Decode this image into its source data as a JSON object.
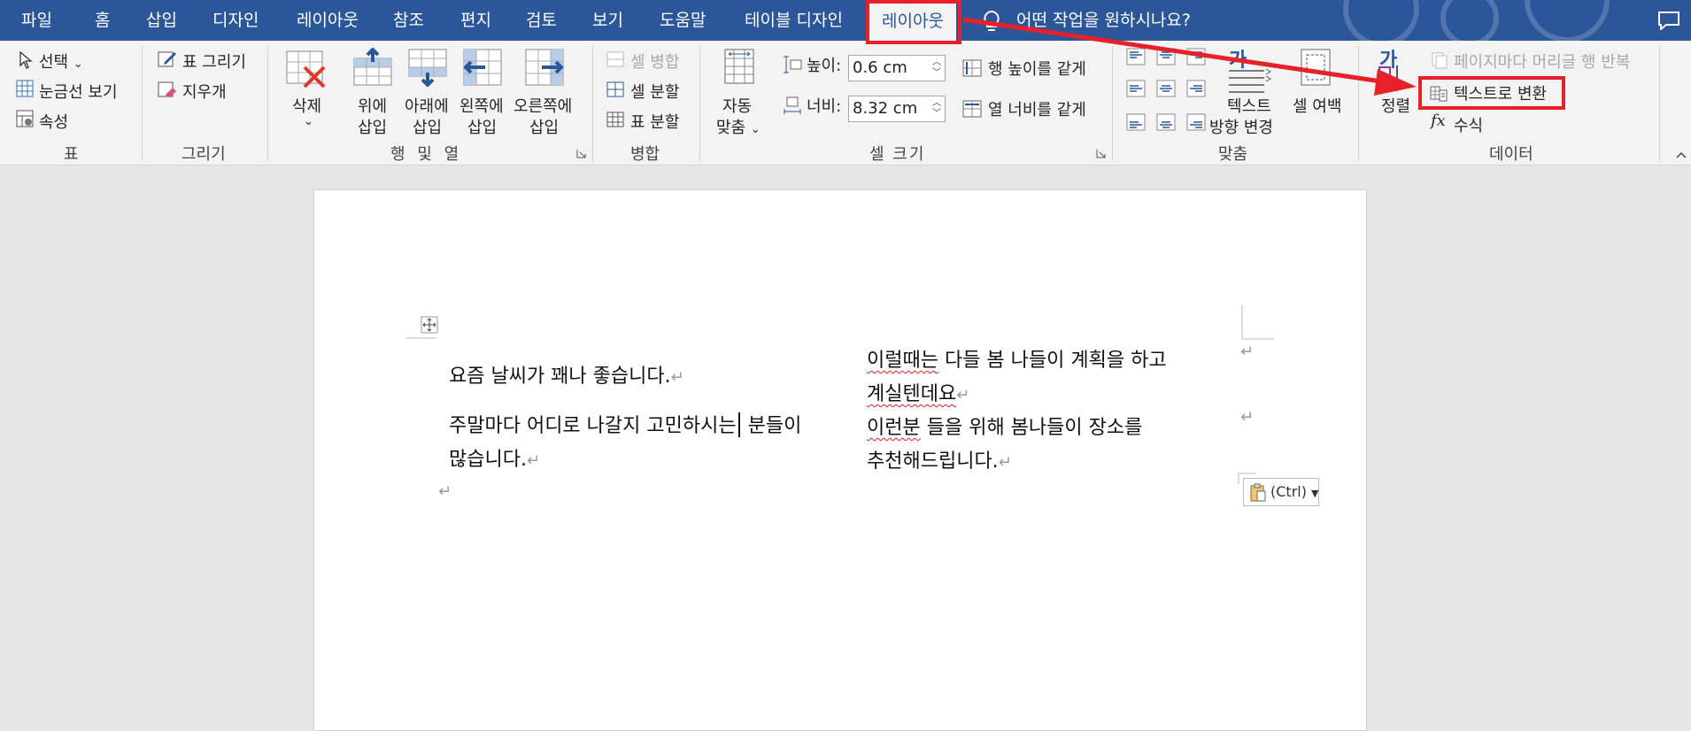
{
  "tabs": [
    {
      "id": "file",
      "label": "파일"
    },
    {
      "id": "home",
      "label": "홈"
    },
    {
      "id": "insert",
      "label": "삽입"
    },
    {
      "id": "design",
      "label": "디자인"
    },
    {
      "id": "layout1",
      "label": "레이아웃"
    },
    {
      "id": "references",
      "label": "참조"
    },
    {
      "id": "mailings",
      "label": "편지"
    },
    {
      "id": "review",
      "label": "검토"
    },
    {
      "id": "view",
      "label": "보기"
    },
    {
      "id": "help",
      "label": "도움말"
    },
    {
      "id": "table-design",
      "label": "테이블 디자인"
    },
    {
      "id": "table-layout",
      "label": "레이아웃"
    }
  ],
  "search": {
    "placeholder": "어떤 작업을 원하시나요?"
  },
  "ribbon": {
    "table": {
      "select": "선택",
      "gridlines": "눈금선 보기",
      "properties": "속성",
      "label": "표"
    },
    "draw": {
      "draw_table": "표 그리기",
      "eraser": "지우개",
      "label": "그리기"
    },
    "rows_cols": {
      "delete": "삭제",
      "insert_above_1": "위에",
      "insert_above_2": "삽입",
      "insert_below_1": "아래에",
      "insert_below_2": "삽입",
      "insert_left_1": "왼쪽에",
      "insert_left_2": "삽입",
      "insert_right_1": "오른쪽에",
      "insert_right_2": "삽입",
      "label": "행 및 열"
    },
    "merge": {
      "merge_cells": "셀 병합",
      "split_cells": "셀 분할",
      "split_table": "표 분할",
      "label": "병합"
    },
    "cell_size": {
      "autofit_1": "자동",
      "autofit_2": "맞춤",
      "height_label": "높이:",
      "height_value": "0.6 cm",
      "width_label": "너비:",
      "width_value": "8.32 cm",
      "distribute_rows": "행 높이를 같게",
      "distribute_cols": "열 너비를 같게",
      "label": "셀 크기"
    },
    "alignment": {
      "text_dir_glyph": "가",
      "text_dir_1": "텍스트",
      "text_dir_2": "방향 변경",
      "margins": "셀 여백",
      "label": "맞춤"
    },
    "data": {
      "sort_glyph": "가",
      "sort": "정렬",
      "repeat_header": "페이지마다 머리글 행 반복",
      "convert_to_text": "텍스트로 변환",
      "formula_glyph": "fx",
      "formula": "수식",
      "label": "데이터"
    }
  },
  "document": {
    "cell1_p1": "요즘 날씨가 꽤나 좋습니다.",
    "cell1_p2a": "주말마다 어디로 나갈지 고민하시는",
    "cell1_p2b": " 분들이",
    "cell1_p2c": "많습니다.",
    "cell2_p1a_underlined": "이럴때는",
    "cell2_p1a_rest": " 다들 봄 나들이 계획을 하고",
    "cell2_p1b": "계실텐데요",
    "cell2_p2a_underlined": "이런분",
    "cell2_p2a_rest": " 들을 위해 봄나들이 장소를",
    "cell2_p2b": "추천해드립니다.",
    "return_mark": "↵",
    "paste_options": "(Ctrl)"
  },
  "colors": {
    "tabbar": "#2b579a",
    "ribbon": "#f3f3f3",
    "highlight": "#e8202a"
  }
}
